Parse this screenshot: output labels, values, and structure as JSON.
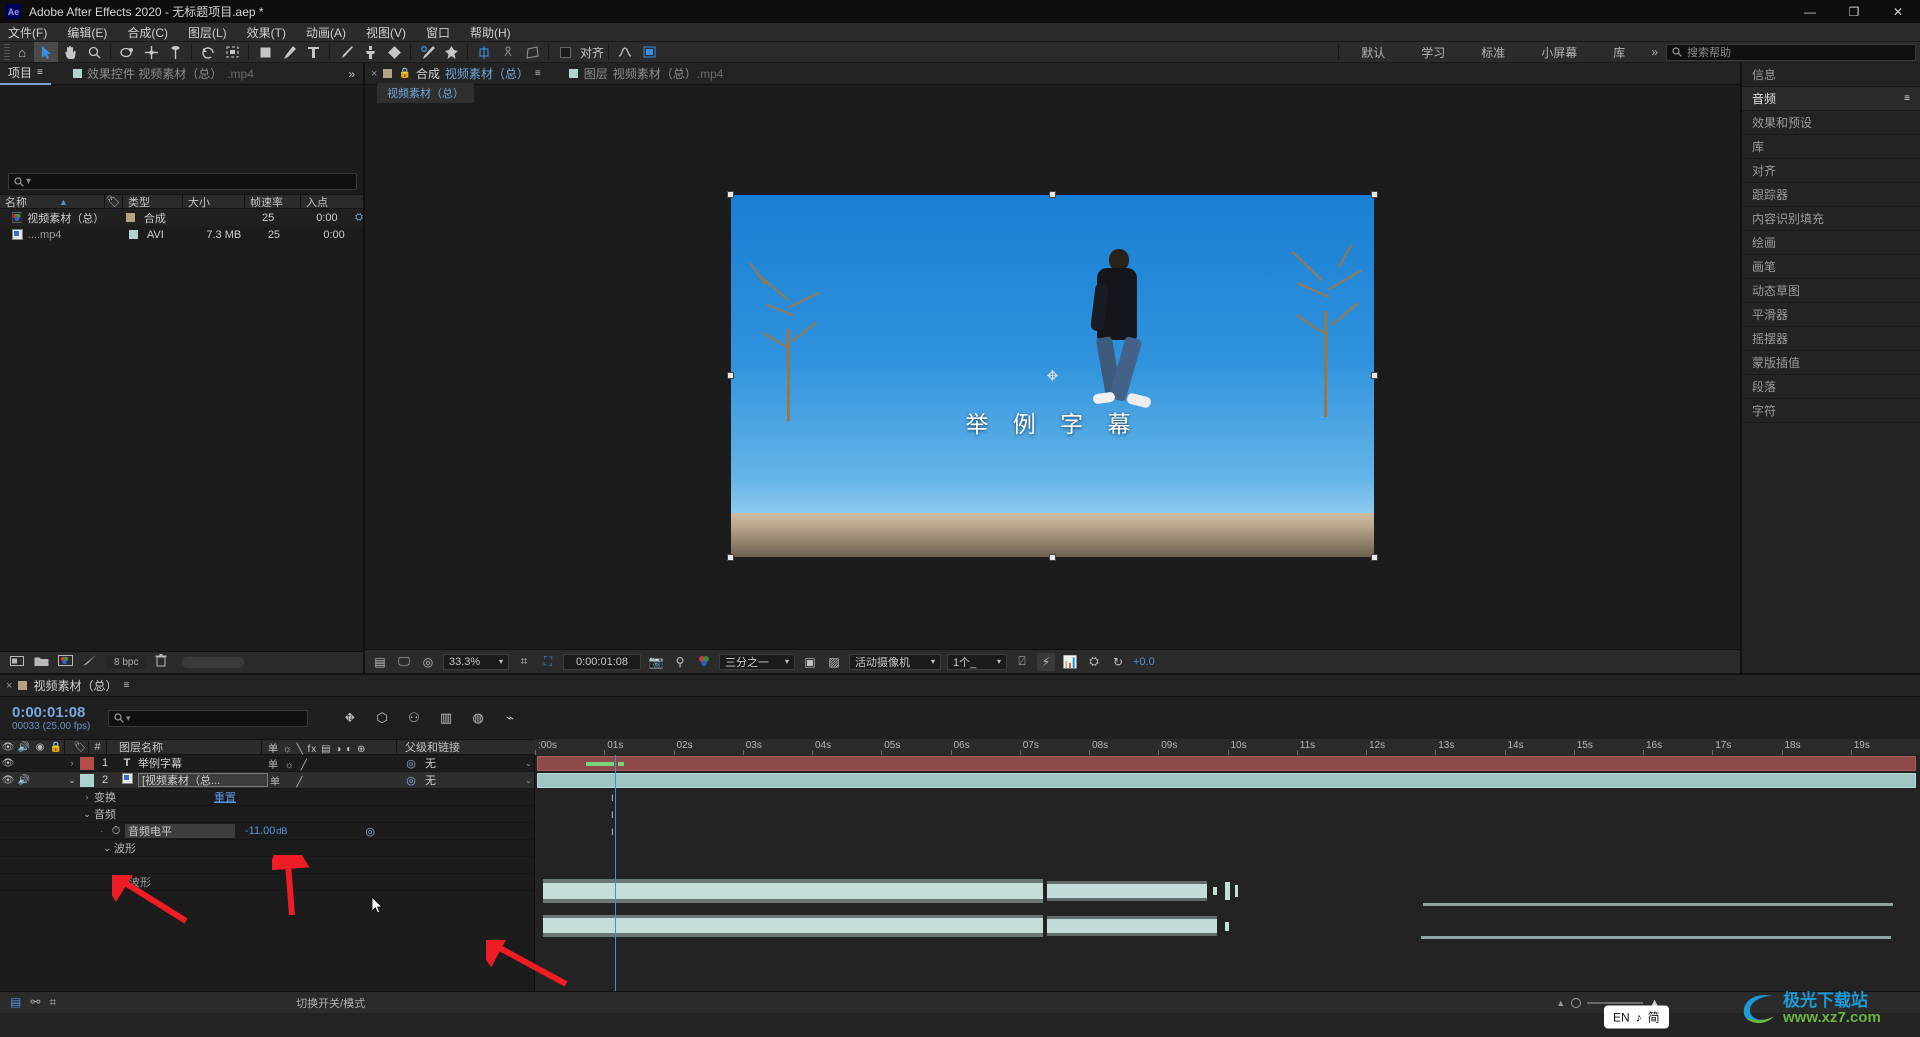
{
  "window": {
    "app_icon": "Ae",
    "title": "Adobe After Effects 2020 - 无标题项目.aep *",
    "minimize": "—",
    "maximize": "❐",
    "close": "✕"
  },
  "menubar": {
    "items": [
      "文件(F)",
      "编辑(E)",
      "合成(C)",
      "图层(L)",
      "效果(T)",
      "动画(A)",
      "视图(V)",
      "窗口",
      "帮助(H)"
    ]
  },
  "toolbar": {
    "tools": [
      {
        "name": "home-icon",
        "glyph": "⌂"
      },
      {
        "name": "selection-tool-icon",
        "glyph": "➤"
      },
      {
        "name": "hand-tool-icon",
        "glyph": "✋"
      },
      {
        "name": "zoom-tool-icon",
        "glyph": "⌕"
      },
      {
        "name": "orbit-tool-icon",
        "glyph": "◍"
      },
      {
        "name": "pan-behind-tool-icon",
        "glyph": "✛"
      },
      {
        "name": "camera-tool-icon",
        "glyph": "⊥"
      },
      {
        "name": "rotation-tool-icon",
        "glyph": "↺"
      },
      {
        "name": "region-of-interest-icon",
        "glyph": "⛶"
      },
      {
        "name": "shape-tool-icon",
        "glyph": "▢"
      },
      {
        "name": "pen-tool-icon",
        "glyph": "✒"
      },
      {
        "name": "type-tool-icon",
        "glyph": "T"
      },
      {
        "name": "brush-tool-icon",
        "glyph": "🖌"
      },
      {
        "name": "clone-stamp-tool-icon",
        "glyph": "⚲"
      },
      {
        "name": "eraser-tool-icon",
        "glyph": "◆"
      },
      {
        "name": "roto-brush-tool-icon",
        "glyph": "⚘"
      },
      {
        "name": "puppet-pin-tool-icon",
        "glyph": "✜"
      },
      {
        "name": "align-panel-icon",
        "glyph": "⇳"
      },
      {
        "name": "snapping-icon",
        "glyph": "⚹"
      },
      {
        "name": "grid-icon",
        "glyph": "⊞"
      }
    ],
    "snap_label": "对齐",
    "extra_icons": [
      {
        "name": "graph-editor-icon",
        "glyph": "〜"
      },
      {
        "name": "motion-blur-icon",
        "glyph": "▩"
      }
    ]
  },
  "workspaces": {
    "tabs": [
      "默认",
      "学习",
      "标准",
      "小屏幕",
      "库"
    ],
    "overflow": "»",
    "search_placeholder": "搜索帮助",
    "search_icon": "search-icon"
  },
  "project_panel": {
    "tabs": [
      {
        "label": "项目",
        "active": true,
        "menu": "≡"
      },
      {
        "label": "效果控件 视频素材（总）",
        "suffix": ".mp4",
        "active": false
      }
    ],
    "overflow": "»",
    "search_placeholder": "",
    "columns": [
      "名称",
      "类型",
      "大小",
      "帧速率",
      "入点"
    ],
    "sort_indicator": "▲",
    "rows": [
      {
        "name": "视频素材（总）",
        "type": "合成",
        "size": "",
        "fps": "25",
        "in_point": "0:00",
        "icon": "composition-icon",
        "chip": "#b5a27e"
      },
      {
        "name": "....mp4",
        "type": "AVI",
        "size": "7.3 MB",
        "fps": "25",
        "in_point": "0:00",
        "icon": "footage-icon",
        "chip": "#aed2ce"
      }
    ],
    "footer": {
      "bit_depth": "8 bpc",
      "icons": [
        "new-folder-icon",
        "folder-icon",
        "new-comp-icon",
        "interpret-footage-icon",
        "delete-icon"
      ]
    }
  },
  "comp_panel": {
    "tabs": [
      {
        "label": "合成",
        "name": "视频素材（总）",
        "active": true,
        "menu": "≡",
        "close": "×",
        "lock": "🔒"
      },
      {
        "label": "图层",
        "name": "视频素材（总）",
        "suffix": ".mp4",
        "active": false
      }
    ],
    "breadcrumb": "视频素材（总）",
    "subtitle_text": "举 例 字 幕",
    "bottom_bar": {
      "zoom": "33.3%",
      "timecode": "0:00:01:08",
      "resolution": "三分之一",
      "camera": "活动摄像机",
      "views": "1个_",
      "exposure": "+0.0",
      "icons": [
        "always-preview-icon",
        "monitor-icon",
        "3d-renderer-icon",
        "region-of-interest-icon",
        "transparency-grid-icon",
        "snapshot-icon",
        "show-snapshot-icon",
        "channel-icon",
        "mask-icon",
        "grid-guides-icon",
        "timeline-icon",
        "comp-flowchart-icon",
        "reset-exposure-icon"
      ]
    }
  },
  "right_dock": {
    "items": [
      {
        "label": "信息",
        "active": false
      },
      {
        "label": "音频",
        "active": true,
        "menu": "≡"
      },
      {
        "label": "效果和预设",
        "active": false
      },
      {
        "label": "库",
        "active": false
      },
      {
        "label": "对齐",
        "active": false
      },
      {
        "label": "跟踪器",
        "active": false
      },
      {
        "label": "内容识别填充",
        "active": false
      },
      {
        "label": "绘画",
        "active": false
      },
      {
        "label": "画笔",
        "active": false
      },
      {
        "label": "动态草图",
        "active": false
      },
      {
        "label": "平滑器",
        "active": false
      },
      {
        "label": "摇摆器",
        "active": false
      },
      {
        "label": "蒙版插值",
        "active": false
      },
      {
        "label": "段落",
        "active": false
      },
      {
        "label": "字符",
        "active": false
      }
    ]
  },
  "timeline": {
    "tab": {
      "label": "视频素材（总）",
      "close": "×",
      "menu": "≡"
    },
    "current_time": "0:00:01:08",
    "frame_info": "00033 (25.00 fps)",
    "search_placeholder": "",
    "header_icons": [
      "composition-mini-flowchart-icon",
      "draft-3d-icon",
      "hide-shy-layers-icon",
      "frame-blending-icon",
      "motion-blur-icon",
      "graph-editor-icon"
    ],
    "columns": {
      "video": "◉",
      "audio": "◀",
      "solo": "●",
      "lock": "🔒",
      "label": "🏷",
      "number": "#",
      "layer_name": "图层名称",
      "switches": "单 ☼ ╲ fx ▤ ◑ ◐ ⊕",
      "parent": "父级和链接"
    },
    "ruler_ticks": [
      ":00s",
      "01s",
      "02s",
      "03s",
      "04s",
      "05s",
      "06s",
      "07s",
      "08s",
      "09s",
      "10s",
      "11s",
      "12s",
      "13s",
      "14s",
      "15s",
      "16s",
      "17s",
      "18s",
      "19s"
    ],
    "layers": [
      {
        "num": "1",
        "name": "举例字幕",
        "type_icon": "T",
        "color": "#b64b4b",
        "parent": "无",
        "audio_enabled": false,
        "expanded": false
      },
      {
        "num": "2",
        "name": "[视频素材（总...",
        "type_icon": "footage",
        "color": "#aed2ce",
        "parent": "无",
        "audio_enabled": true,
        "expanded": true,
        "selected": true
      }
    ],
    "properties": [
      {
        "label": "变换",
        "value": "重置",
        "indent": 1,
        "twirl": "›"
      },
      {
        "label": "音频",
        "value": "",
        "indent": 1,
        "twirl": "⌄"
      },
      {
        "label": "音频电平",
        "value": "-11.00",
        "unit": "dB",
        "indent": 2,
        "stopwatch": true
      },
      {
        "label": "波形",
        "value": "",
        "indent": 2,
        "twirl": "⌄"
      },
      {
        "label": "波形",
        "value": "",
        "indent": 3
      }
    ],
    "footer": {
      "toggle_label": "切换开关/模式",
      "icons": [
        "frame-render-icon",
        "snapshot-icon",
        "motion-icon"
      ]
    }
  },
  "annotations": {
    "arrow_color": "#ee1c24",
    "arrows": 3
  },
  "overlays": {
    "ime": {
      "lang": "EN",
      "note": "♪",
      "mode": "简"
    },
    "watermark": {
      "title": "极光下载站",
      "url": "www.xz7.com"
    }
  },
  "colors": {
    "accent_blue": "#3e8ede",
    "panel_bg": "#1c1c1c",
    "chrome_bg": "#2b2b2b",
    "title_bg": "#0e0e0e"
  }
}
